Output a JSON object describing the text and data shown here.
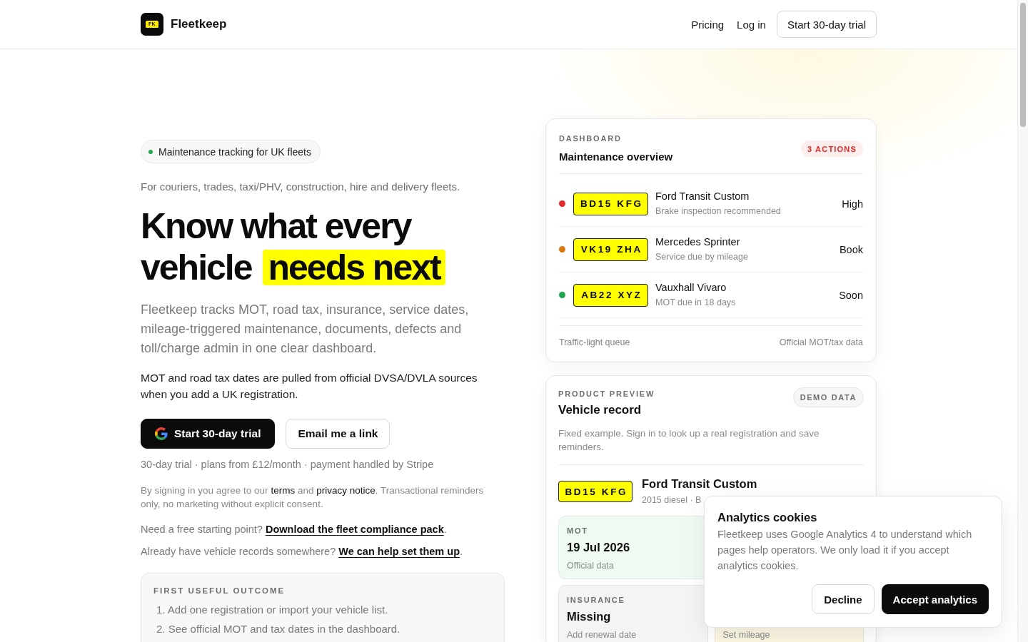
{
  "header": {
    "logo_mark": "FK",
    "brand": "Fleetkeep",
    "nav": [
      {
        "label": "Pricing"
      },
      {
        "label": "Log in"
      }
    ],
    "cta": "Start 30-day trial"
  },
  "hero": {
    "tag": "Maintenance tracking for UK fleets",
    "audience": "For couriers, trades, taxi/PHV, construction, hire and delivery fleets.",
    "headline": {
      "text": "Know what every vehicle",
      "highlight": "needs next"
    },
    "lead": "Fleetkeep tracks MOT, road tax, insurance, service dates, mileage-triggered maintenance, documents, defects and toll/charge admin in one clear dashboard.",
    "note": "MOT and road tax dates are pulled from official DVSA/DVLA sources when you add a UK registration.",
    "buttons": [
      {
        "label": "Start 30-day trial",
        "kind": "google"
      },
      {
        "label": "Email me a link",
        "kind": "outline"
      }
    ],
    "pricing_note": "30-day trial · plans from £12/month · payment handled by Stripe",
    "consent": [
      {
        "kind": "text",
        "text": "By signing in you agree to our "
      },
      {
        "kind": "link",
        "text": "terms"
      },
      {
        "kind": "text",
        "text": " and "
      },
      {
        "kind": "link",
        "text": "privacy notice"
      },
      {
        "kind": "text",
        "text": ". Transactional reminders only, no marketing without explicit consent."
      }
    ],
    "help_lines": [
      [
        {
          "kind": "text",
          "text": "Need a free starting point? "
        },
        {
          "kind": "cta_link",
          "text": "Download the fleet compliance pack"
        },
        {
          "kind": "text",
          "text": "."
        }
      ],
      [
        {
          "kind": "text",
          "text": "Already have vehicle records somewhere? "
        },
        {
          "kind": "cta_link",
          "text": "We can help set them up"
        },
        {
          "kind": "text",
          "text": "."
        }
      ]
    ],
    "outcome": {
      "title": "FIRST USEFUL OUTCOME",
      "steps": [
        "1. Add one registration or import your vehicle list.",
        "2. See official MOT and tax dates in the dashboard."
      ]
    }
  },
  "dashboard": {
    "label": "DASHBOARD",
    "title": "Maintenance overview",
    "badge": "3 ACTIONS",
    "rows": [
      {
        "color": "#e22b2b",
        "plate": "BD15 KFG",
        "vehicle": "Ford Transit Custom",
        "detail": "Brake inspection recommended",
        "action": "High"
      },
      {
        "color": "#dc7a0e",
        "plate": "VK19 ZHA",
        "vehicle": "Mercedes Sprinter",
        "detail": "Service due by mileage",
        "action": "Book"
      },
      {
        "color": "#1fa64c",
        "plate": "AB22 XYZ",
        "vehicle": "Vauxhall Vivaro",
        "detail": "MOT due in 18 days",
        "action": "Soon"
      }
    ],
    "footer": {
      "left": "Traffic-light queue",
      "right": "Official MOT/tax data"
    }
  },
  "vehicle_record": {
    "label": "PRODUCT PREVIEW",
    "title": "Vehicle record",
    "badge": "DEMO DATA",
    "description": "Fixed example. Sign in to look up a real registration and save reminders.",
    "plate": "BD15 KFG",
    "vehicle": "Ford Transit Custom",
    "detail": "2015 diesel · B",
    "tile_rows": [
      {
        "tiles": [
          {
            "label": "MOT",
            "value": "19 Jul 2026",
            "note": "Official data",
            "color": "#effaf2"
          }
        ]
      },
      {
        "tiles": [
          {
            "label": "INSURANCE",
            "value": "Missing",
            "note": "Add renewal date",
            "color": "#f4f4f4"
          },
          {
            "note": "Set mileage",
            "color": "#fbf6e2"
          }
        ]
      }
    ]
  },
  "cookie_banner": {
    "title": "Analytics cookies",
    "text": "Fleetkeep uses Google Analytics 4 to understand which pages help operators. We only load it if you accept analytics cookies.",
    "buttons": [
      {
        "label": "Decline",
        "kind": "outline"
      },
      {
        "label": "Accept analytics",
        "kind": "primary"
      }
    ]
  }
}
